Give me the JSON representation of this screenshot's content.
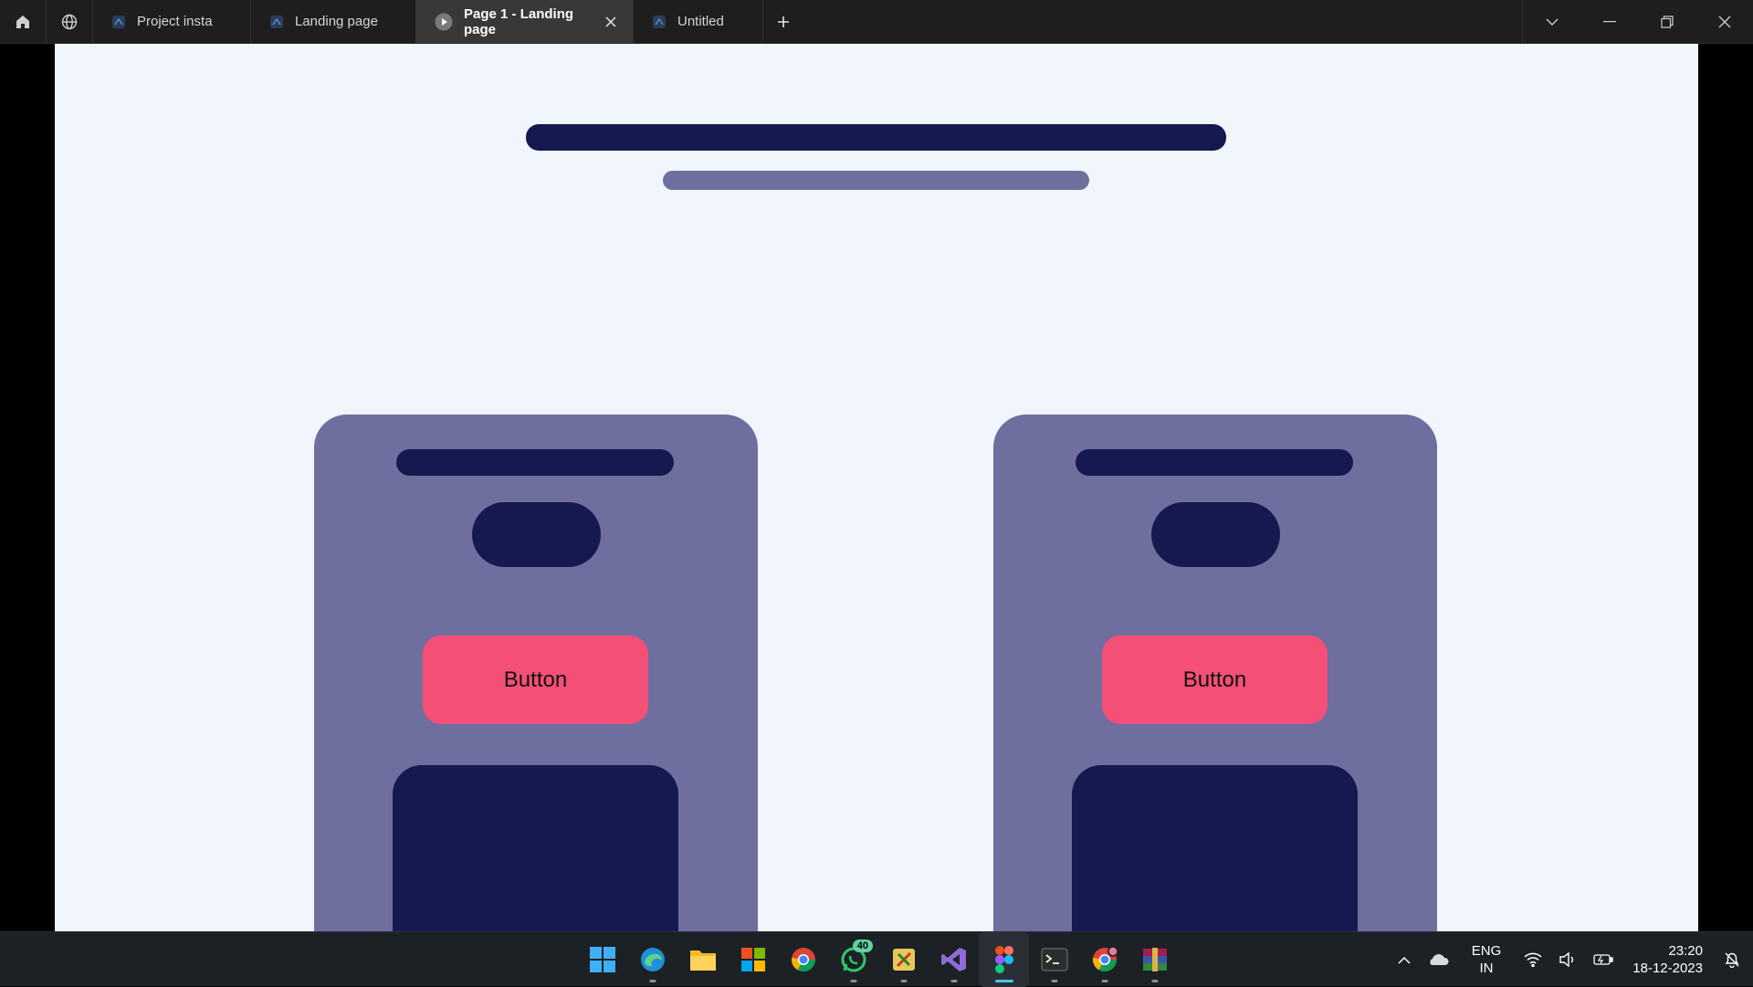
{
  "titlebar": {
    "tabs": [
      {
        "label": "Project insta",
        "icon": "figma-file-icon"
      },
      {
        "label": "Landing page",
        "icon": "figma-file-icon"
      },
      {
        "label": "Page 1 - Landing page",
        "icon": "play-icon",
        "active": true
      },
      {
        "label": "Untitled",
        "icon": "figma-file-icon"
      }
    ]
  },
  "canvas": {
    "cards": [
      {
        "button_label": "Button"
      },
      {
        "button_label": "Button"
      }
    ]
  },
  "taskbar": {
    "apps": [
      "start",
      "edge",
      "file-explorer",
      "microsoft-store",
      "chrome",
      "whatsapp",
      "tools",
      "visual-studio",
      "figma",
      "terminal",
      "chrome-alt",
      "winrar"
    ],
    "whatsapp_badge": "40",
    "language": "ENG",
    "region": "IN",
    "time": "23:20",
    "date": "18-12-2023"
  },
  "colors": {
    "navy": "#16194f",
    "slate": "#6e6e9f",
    "pink": "#f44f76",
    "canvas_bg": "#f1f6fd"
  }
}
